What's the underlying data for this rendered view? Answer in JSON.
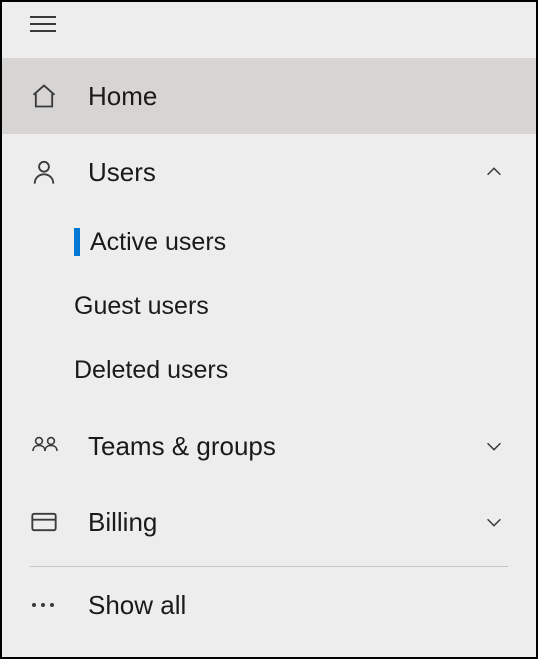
{
  "nav": {
    "items": [
      {
        "id": "home",
        "label": "Home",
        "icon": "home-icon",
        "selected": true,
        "expandable": false
      },
      {
        "id": "users",
        "label": "Users",
        "icon": "person-icon",
        "selected": false,
        "expandable": true,
        "expanded": true,
        "sub": [
          {
            "id": "active-users",
            "label": "Active users",
            "active": true
          },
          {
            "id": "guest-users",
            "label": "Guest users",
            "active": false
          },
          {
            "id": "deleted-users",
            "label": "Deleted users",
            "active": false
          }
        ]
      },
      {
        "id": "teams",
        "label": "Teams & groups",
        "icon": "people-icon",
        "selected": false,
        "expandable": true,
        "expanded": false
      },
      {
        "id": "billing",
        "label": "Billing",
        "icon": "card-icon",
        "selected": false,
        "expandable": true,
        "expanded": false
      }
    ],
    "show_all": "Show all"
  }
}
